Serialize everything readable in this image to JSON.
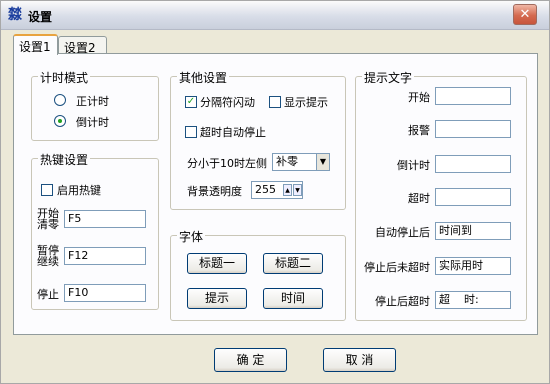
{
  "window": {
    "title": "设置",
    "app_icon": "window-app-icon",
    "close_glyph": "✕"
  },
  "tabs": [
    {
      "label": "设置1"
    },
    {
      "label": "设置2"
    }
  ],
  "timing_mode": {
    "title": "计时模式",
    "options": [
      {
        "label": "正计时",
        "checked": false
      },
      {
        "label": "倒计时",
        "checked": true
      }
    ]
  },
  "hotkeys": {
    "title": "热键设置",
    "enable_label": "启用热键",
    "enabled": false,
    "start_label": "开始清零",
    "start_value": "F5",
    "pause_label": "暂停继续",
    "pause_value": "F12",
    "stop_label": "停止",
    "stop_value": "F10"
  },
  "other": {
    "title": "其他设置",
    "separator_blink_label": "分隔符闪动",
    "separator_blink": true,
    "show_tip_label": "显示提示",
    "show_tip": false,
    "auto_stop_label": "超时自动停止",
    "auto_stop": false,
    "minutes_label": "分小于10时左侧",
    "minutes_value": "补零",
    "opacity_label": "背景透明度",
    "opacity_value": "255"
  },
  "font": {
    "title": "字体",
    "buttons": [
      {
        "label": "标题一"
      },
      {
        "label": "标题二"
      },
      {
        "label": "提示"
      },
      {
        "label": "时间"
      }
    ]
  },
  "prompt": {
    "title": "提示文字",
    "rows": [
      {
        "label": "开始",
        "value": ""
      },
      {
        "label": "报警",
        "value": ""
      },
      {
        "label": "倒计时",
        "value": ""
      },
      {
        "label": "超时",
        "value": ""
      },
      {
        "label": "自动停止后",
        "value": "时间到"
      },
      {
        "label": "停止后未超时",
        "value": "实际用时"
      },
      {
        "label": "停止后超时",
        "value": "超    时:"
      }
    ]
  },
  "footer": {
    "ok_label": "确    定",
    "cancel_label": "取    消"
  }
}
